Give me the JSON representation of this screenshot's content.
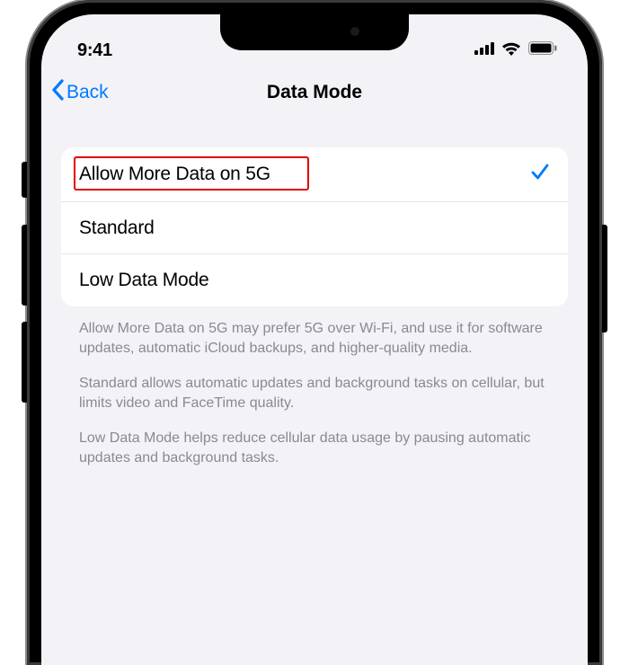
{
  "statusBar": {
    "time": "9:41"
  },
  "nav": {
    "backLabel": "Back",
    "title": "Data Mode"
  },
  "options": {
    "allowMore": {
      "label": "Allow More Data on 5G",
      "selected": true
    },
    "standard": {
      "label": "Standard",
      "selected": false
    },
    "lowData": {
      "label": "Low Data Mode",
      "selected": false
    }
  },
  "footer": {
    "p1": "Allow More Data on 5G may prefer 5G over Wi-Fi, and use it for software updates, automatic iCloud backups, and higher-quality media.",
    "p2": "Standard allows automatic updates and background tasks on cellular, but limits video and FaceTime quality.",
    "p3": "Low Data Mode helps reduce cellular data usage by pausing automatic updates and background tasks."
  }
}
